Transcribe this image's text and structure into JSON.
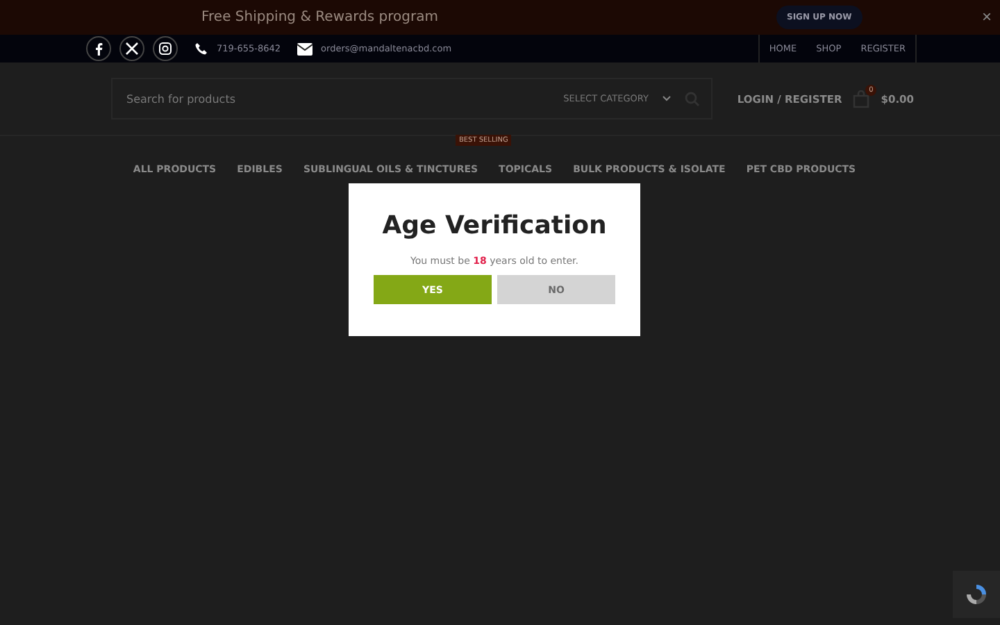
{
  "promo_bar": {
    "text": "Free Shipping & Rewards program",
    "button": "SIGN UP NOW",
    "close": "×"
  },
  "top_bar": {
    "phone": "719-655-8642",
    "email": "orders@mandaltenacbd.com",
    "links": [
      "HOME",
      "SHOP",
      "REGISTER"
    ]
  },
  "header": {
    "search": {
      "placeholder": "Search for products",
      "category": "SELECT CATEGORY"
    },
    "account": "LOGIN / REGISTER",
    "cart": {
      "count": "0",
      "total": "$0.00"
    }
  },
  "nav": [
    {
      "label": "ALL PRODUCTS"
    },
    {
      "label": "EDIBLES"
    },
    {
      "label": "SUBLINGUAL OILS & TINCTURES",
      "badge": "BEST SELLING"
    },
    {
      "label": "TOPICALS"
    },
    {
      "label": "BULK PRODUCTS & ISOLATE"
    },
    {
      "label": "PET CBD PRODUCTS"
    }
  ],
  "dialog": {
    "title": "Age Verification",
    "message": "You must be **18** years old to enter.",
    "buttons": [
      {
        "label": "YES",
        "kind": "primary"
      },
      {
        "label": "NO",
        "kind": "secondary"
      }
    ]
  }
}
